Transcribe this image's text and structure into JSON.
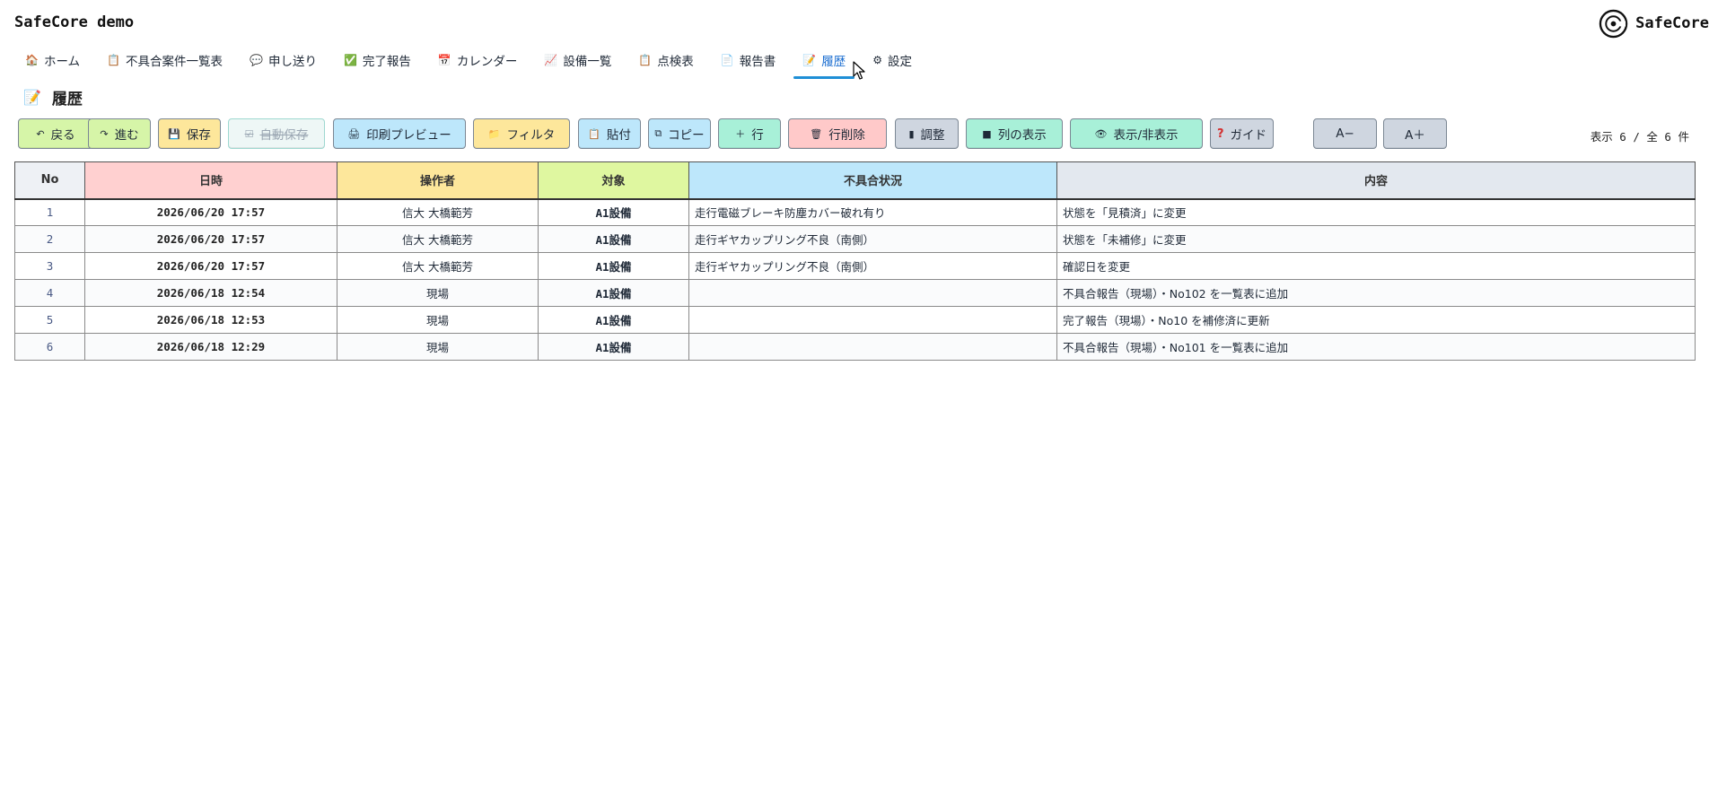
{
  "app_title": "SafeCore demo",
  "brand": {
    "name": "SafeCore"
  },
  "nav": [
    {
      "label": "ホーム",
      "icon": "house-icon",
      "glyph": "🏠",
      "active": false
    },
    {
      "label": "不具合案件一覧表",
      "icon": "clipboard-icon",
      "glyph": "📋",
      "active": false
    },
    {
      "label": "申し送り",
      "icon": "speech-bubble-icon",
      "glyph": "💬",
      "active": false
    },
    {
      "label": "完了報告",
      "icon": "check-icon",
      "glyph": "✅",
      "active": false
    },
    {
      "label": "カレンダー",
      "icon": "calendar-icon",
      "glyph": "📅",
      "active": false
    },
    {
      "label": "設備一覧",
      "icon": "chart-icon",
      "glyph": "📈",
      "active": false
    },
    {
      "label": "点検表",
      "icon": "clipboard-icon",
      "glyph": "📋",
      "active": false
    },
    {
      "label": "報告書",
      "icon": "document-icon",
      "glyph": "📄",
      "active": false
    },
    {
      "label": "履歴",
      "icon": "history-doc-icon",
      "glyph": "📝",
      "active": true
    },
    {
      "label": "設定",
      "icon": "gear-icon",
      "glyph": "⚙",
      "active": false
    }
  ],
  "page": {
    "title": "履歴",
    "icon_glyph": "📝"
  },
  "toolbar": {
    "back": {
      "label": "戻る",
      "glyph": "↶"
    },
    "forward": {
      "label": "進む",
      "glyph": "↷"
    },
    "save": {
      "label": "保存",
      "glyph": "💾"
    },
    "autosave": {
      "label": "自動保存",
      "glyph": "☑"
    },
    "print_preview": {
      "label": "印刷プレビュー",
      "glyph": "🖨"
    },
    "filter": {
      "label": "フィルタ",
      "glyph": "📁"
    },
    "paste": {
      "label": "貼付",
      "glyph": "📋"
    },
    "copy": {
      "label": "コピー",
      "glyph": "⧉"
    },
    "add_row": {
      "label": "行",
      "glyph": "＋"
    },
    "delete_row": {
      "label": "行削除",
      "glyph": "🗑"
    },
    "adjust": {
      "label": "調整",
      "glyph": "▮"
    },
    "column_display": {
      "label": "列の表示",
      "glyph": "■"
    },
    "show_hide": {
      "label": "表示/非表示",
      "glyph": "👁"
    },
    "guide": {
      "label": "ガイド",
      "glyph": "?"
    },
    "font_down": {
      "label": "A−"
    },
    "font_up": {
      "label": "A＋"
    }
  },
  "count_info": "表示 6 / 全 6 件",
  "table": {
    "headers": [
      "No",
      "日時",
      "操作者",
      "対象",
      "不具合状況",
      "内容"
    ],
    "header_colors": [
      "#eef1f5",
      "#ffd0d0",
      "#fde79b",
      "#dff7a0",
      "#bde7fb",
      "#e3e8ef"
    ],
    "rows": [
      [
        "1",
        "2026/06/20 17:57",
        "信大 大橋範芳",
        "A1設備",
        "走行電磁ブレーキ防塵カバー破れ有り",
        "状態を「見積済」に変更"
      ],
      [
        "2",
        "2026/06/20 17:57",
        "信大 大橋範芳",
        "A1設備",
        "走行ギヤカップリング不良（南側）",
        "状態を「未補修」に変更"
      ],
      [
        "3",
        "2026/06/20 17:57",
        "信大 大橋範芳",
        "A1設備",
        "走行ギヤカップリング不良（南側）",
        "確認日を変更"
      ],
      [
        "4",
        "2026/06/18 12:54",
        "現場",
        "A1設備",
        "",
        "不具合報告（現場）・No102 を一覧表に追加"
      ],
      [
        "5",
        "2026/06/18 12:53",
        "現場",
        "A1設備",
        "",
        "完了報告（現場）・No10 を補修済に更新"
      ],
      [
        "6",
        "2026/06/18 12:29",
        "現場",
        "A1設備",
        "",
        "不具合報告（現場）・No101 を一覧表に追加"
      ]
    ]
  },
  "colors": {
    "active_tab": "#1f8fd6",
    "btn_green": "#d6f5a8",
    "btn_yellow": "#fde79b",
    "btn_blue": "#bde7fb",
    "btn_teal": "#a8f0d8",
    "btn_red": "#ffc9c9",
    "btn_gray": "#cfd6e0"
  }
}
